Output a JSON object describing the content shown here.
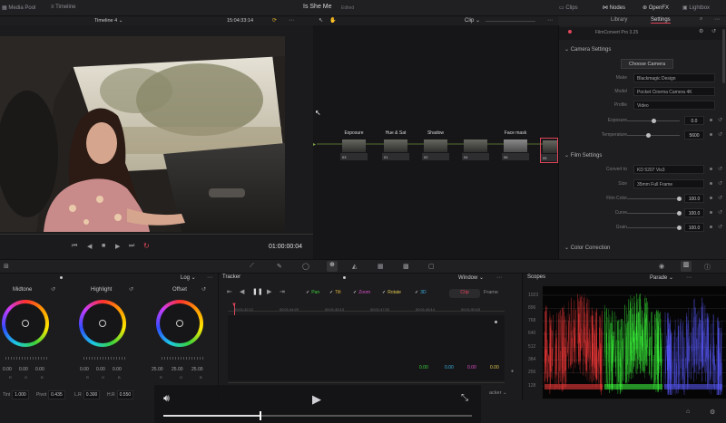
{
  "topbar": {
    "media_pool": "Media Pool",
    "timeline": "Timeline",
    "project": "Is She Me",
    "edited": "Edited",
    "clips": "Clips",
    "nodes": "Nodes",
    "openfx": "OpenFX",
    "lightbox": "Lightbox"
  },
  "viewer": {
    "timeline_name": "Timeline 4",
    "timecode_top": "15:04:33:14",
    "timecode": "01:00:00:04"
  },
  "nodes": {
    "mode": "Clip",
    "items": [
      {
        "label": "Exposure",
        "num": "03"
      },
      {
        "label": "Hue & Sat",
        "num": "01"
      },
      {
        "label": "Shadow",
        "num": "02"
      },
      {
        "label": "",
        "num": "04"
      },
      {
        "label": "Face mask",
        "num": "06"
      },
      {
        "label": "",
        "num": "05"
      }
    ]
  },
  "inspector": {
    "tab_library": "Library",
    "tab_settings": "Settings",
    "plugin": "FilmConvert Pro 3.25",
    "camera_section": "Camera Settings",
    "choose_camera": "Choose Camera",
    "make_label": "Make",
    "make_value": "Blackmagic Design",
    "model_label": "Model",
    "model_value": "Pocket Cinema Camera 4K",
    "profile_label": "Profile",
    "profile_value": "Video",
    "exposure_label": "Exposure",
    "exposure_value": "0.0",
    "temperature_label": "Temperature",
    "temperature_value": "5600",
    "film_section": "Film Settings",
    "convert_label": "Convert to",
    "convert_value": "KD 5207 Vis3",
    "size_label": "Size",
    "size_value": "35mm Full Frame",
    "filmcolor_label": "Film Color",
    "filmcolor_value": "100.0",
    "curve_label": "Curve",
    "curve_value": "100.0",
    "grain_label": "Grain",
    "grain_value": "100.0",
    "color_section": "Color Correction"
  },
  "wheels": {
    "mode": "Log",
    "midtone": "Midtone",
    "highlight": "Highlight",
    "offset": "Offset",
    "mid_vals": [
      "0.00",
      "0.00",
      "0.00"
    ],
    "high_vals": [
      "0.00",
      "0.00",
      "0.00"
    ],
    "off_vals": [
      "25.00",
      "25.00",
      "25.00"
    ],
    "letters_rgb": [
      "R",
      "G",
      "B"
    ],
    "tint_label": "Tint",
    "tint_value": "1.000",
    "pivot_label": "Pivot",
    "pivot_value": "0.435",
    "lr_label": "L.R",
    "lr_value": "0.300",
    "hr_label": "H.R",
    "hr_value": "0.550"
  },
  "tracker": {
    "title": "Tracker",
    "window": "Window",
    "pan": "Pan",
    "tilt": "Tilt",
    "zoom": "Zoom",
    "rotate": "Rotate",
    "threed": "3D",
    "clip": "Clip",
    "frame": "Frame",
    "ticks": [
      "00:01:42:12",
      "00:01:44:20",
      "00:01:45:13",
      "00:01:47:02",
      "00:01:48:14",
      "00:01:50:03"
    ],
    "values": [
      "0.00",
      "0.00",
      "0.00",
      "0.00"
    ],
    "bottom_label": "acker"
  },
  "scopes": {
    "title": "Scopes",
    "mode": "Parade",
    "ticks": [
      "1023",
      "896",
      "768",
      "640",
      "512",
      "384",
      "256",
      "128"
    ]
  },
  "colors": {
    "accent": "#e0455a",
    "red_trace": "#ff3c3c",
    "green_trace": "#3cff3c",
    "blue_trace": "#5a5aff"
  }
}
